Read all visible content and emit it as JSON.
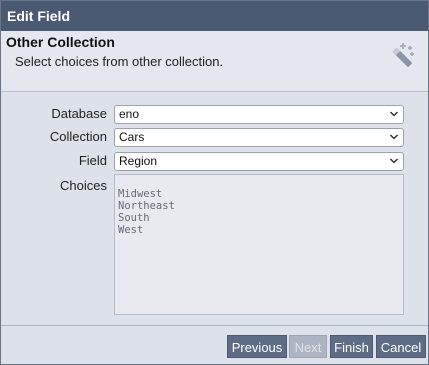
{
  "window": {
    "title": "Edit Field"
  },
  "header": {
    "title": "Other Collection",
    "subtitle": "Select choices from other collection.",
    "icon": "magic-wand-icon"
  },
  "form": {
    "database_label": "Database",
    "database_value": "eno",
    "collection_label": "Collection",
    "collection_value": "Cars",
    "field_label": "Field",
    "field_value": "Region",
    "choices_label": "Choices",
    "choices": [
      "Midwest",
      "Northeast",
      "South",
      "West"
    ]
  },
  "footer": {
    "previous_label": "Previous",
    "next_label": "Next",
    "finish_label": "Finish",
    "cancel_label": "Cancel",
    "next_disabled": true
  },
  "colors": {
    "titlebar": "#4b5a73",
    "button": "#5e6d86",
    "button_disabled": "#aeb5c2",
    "background": "#dde1ea"
  }
}
